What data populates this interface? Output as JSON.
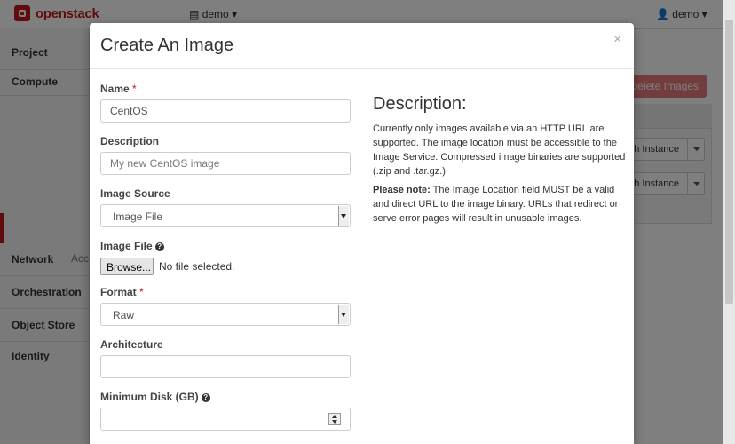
{
  "app": {
    "logo_text": "openstack",
    "project_dropdown": "demo",
    "user_dropdown": "demo"
  },
  "sidebar": {
    "items": [
      "Project",
      "Compute",
      "Network",
      "Orchestration",
      "Object Store",
      "Identity"
    ],
    "access_label": "Acc"
  },
  "background": {
    "delete_images_label": "Delete Images",
    "table_header_fragment": "s",
    "launch_label": "ch Instance"
  },
  "modal": {
    "title": "Create An Image",
    "close_symbol": "×",
    "fields": {
      "name_label": "Name",
      "name_value": "CentOS",
      "required_mark": "*",
      "description_label": "Description",
      "description_placeholder": "My new CentOS image",
      "image_source_label": "Image Source",
      "image_source_value": "Image File",
      "image_file_label": "Image File",
      "browse_label": "Browse...",
      "no_file_text": "No file selected.",
      "format_label": "Format",
      "format_value": "Raw",
      "architecture_label": "Architecture",
      "min_disk_label": "Minimum Disk (GB)"
    },
    "description_panel": {
      "heading": "Description:",
      "body": "Currently only images available via an HTTP URL are supported. The image location must be accessible to the Image Service. Compressed image binaries are supported (.zip and .tar.gz.)",
      "note_label": "Please note:",
      "note_body": " The Image Location field MUST be a valid and direct URL to the image binary. URLs that redirect or serve error pages will result in unusable images."
    }
  },
  "colors": {
    "brand": "#c4161c",
    "delete_button": "#e87a7a",
    "overlay": "rgba(0,0,0,0.5)"
  },
  "icons": {
    "help": "question-circle-icon",
    "user": "user-icon",
    "project": "project-list-icon"
  }
}
